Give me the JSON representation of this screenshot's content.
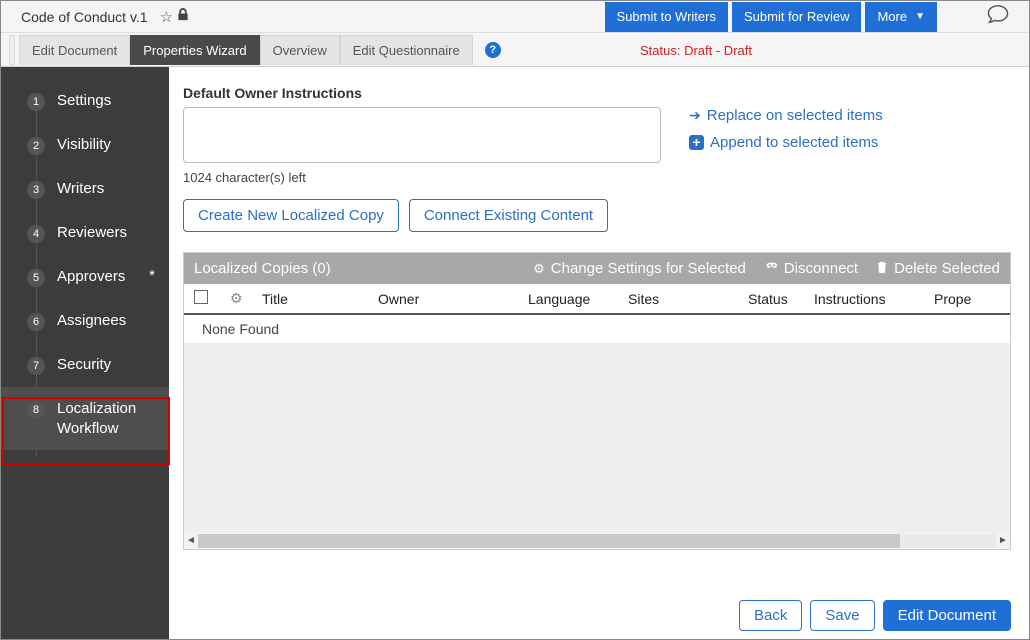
{
  "header": {
    "doc_title": "Code of Conduct v.1",
    "submit_writers": "Submit to Writers",
    "submit_review": "Submit for Review",
    "more": "More"
  },
  "tabs": {
    "edit_document": "Edit Document",
    "properties_wizard": "Properties Wizard",
    "overview": "Overview",
    "edit_questionnaire": "Edit Questionnaire"
  },
  "status": "Status: Draft - Draft",
  "sidebar": [
    {
      "num": "1",
      "label": "Settings"
    },
    {
      "num": "2",
      "label": "Visibility"
    },
    {
      "num": "3",
      "label": "Writers"
    },
    {
      "num": "4",
      "label": "Reviewers"
    },
    {
      "num": "5",
      "label": "Approvers",
      "star": "*"
    },
    {
      "num": "6",
      "label": "Assignees"
    },
    {
      "num": "7",
      "label": "Security"
    },
    {
      "num": "8",
      "label": "Localization Workflow"
    }
  ],
  "content": {
    "instructions_heading": "Default Owner Instructions",
    "char_left": "1024 character(s) left",
    "replace_link": "Replace on selected items",
    "append_link": "Append to selected items",
    "btn_create": "Create New Localized Copy",
    "btn_connect": "Connect Existing Content"
  },
  "grid": {
    "title": "Localized Copies (0)",
    "action_change": "Change Settings for Selected",
    "action_disconnect": "Disconnect",
    "action_delete": "Delete Selected",
    "cols": {
      "title": "Title",
      "owner": "Owner",
      "language": "Language",
      "sites": "Sites",
      "status": "Status",
      "instructions": "Instructions",
      "properties": "Prope"
    },
    "none_found": "None Found"
  },
  "footer": {
    "back": "Back",
    "save": "Save",
    "edit": "Edit Document"
  }
}
